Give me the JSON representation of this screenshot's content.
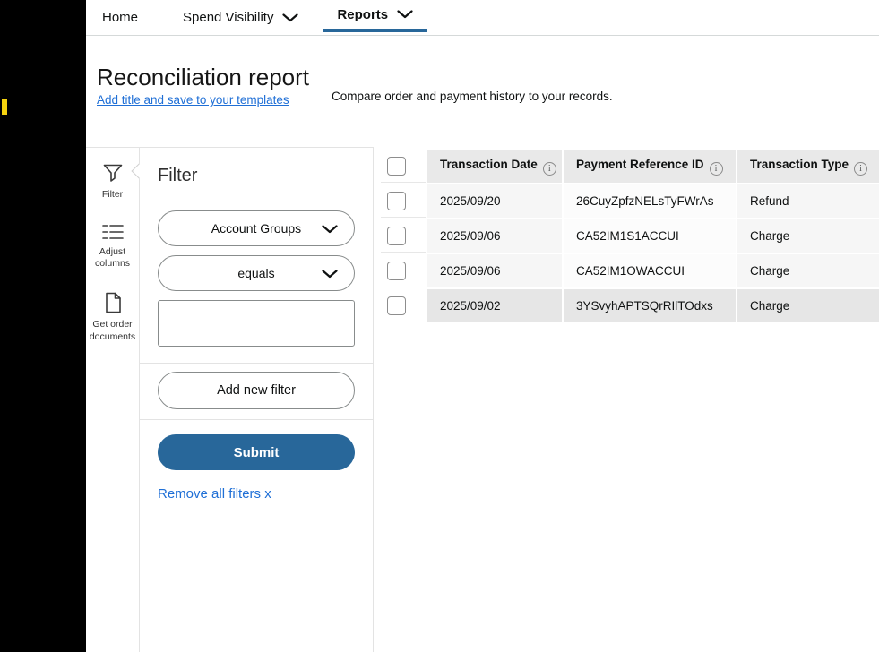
{
  "nav": {
    "items": [
      {
        "label": "Home"
      },
      {
        "label": "Spend Visibility"
      },
      {
        "label": "Reports"
      }
    ]
  },
  "header": {
    "title": "Reconciliation report",
    "save_link": "Add title and save to your templates",
    "description": "Compare order and payment history to your records."
  },
  "rail": {
    "items": [
      {
        "label": "Filter"
      },
      {
        "label": "Adjust columns"
      },
      {
        "label": "Get order documents"
      }
    ]
  },
  "filter_panel": {
    "heading": "Filter",
    "field_select": "Account Groups",
    "operator_select": "equals",
    "value_input": "",
    "add_filter_label": "Add new filter",
    "submit_label": "Submit",
    "remove_all_label": "Remove all filters x"
  },
  "table": {
    "columns": [
      "Transaction Date",
      "Payment Reference ID",
      "Transaction Type"
    ],
    "info_icon_glyph": "i",
    "rows": [
      {
        "date": "2025/09/20",
        "reference": "26CuyZpfzNELsTyFWrAs",
        "type": "Refund"
      },
      {
        "date": "2025/09/06",
        "reference": "CA52IM1S1ACCUI",
        "type": "Charge"
      },
      {
        "date": "2025/09/06",
        "reference": "CA52IM1OWACCUI",
        "type": "Charge"
      },
      {
        "date": "2025/09/02",
        "reference": "3YSvyhAPTSQrRIlTOdxs",
        "type": "Charge"
      }
    ]
  },
  "colors": {
    "accent_blue": "#28679a",
    "link_blue": "#1f6fd6",
    "header_grey": "#e9e9e9",
    "cell_grey": "#f6f6f6",
    "selected_grey": "#e6e6e6",
    "marker_yellow": "#f5d20e"
  }
}
